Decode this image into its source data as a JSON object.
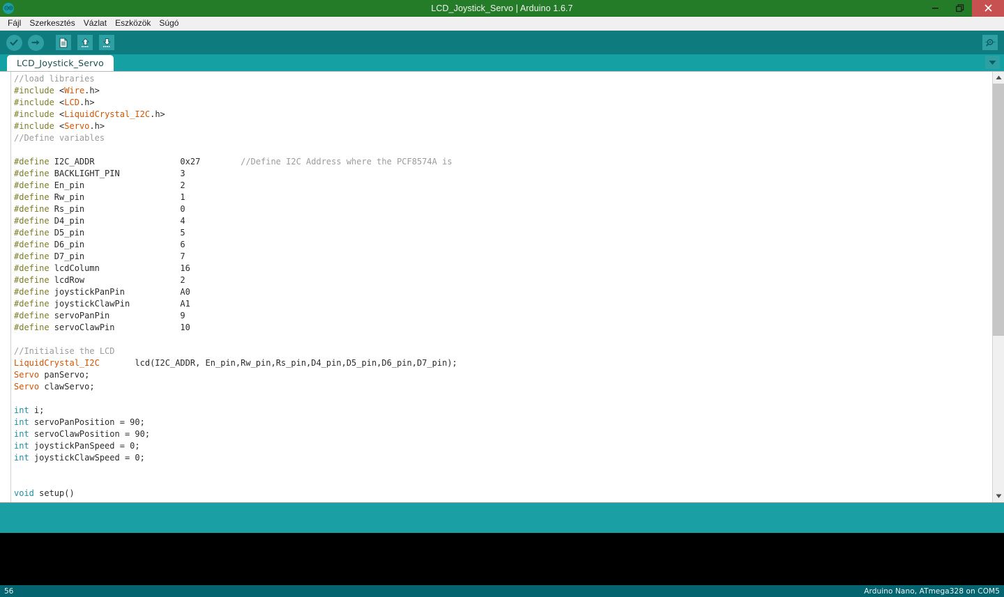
{
  "window": {
    "title": "LCD_Joystick_Servo | Arduino 1.6.7",
    "logo_icon": "arduino-logo-icon",
    "minimize_icon": "minimize-icon",
    "restore_icon": "restore-icon",
    "close_icon": "close-icon",
    "titlebar_color": "#257c28",
    "close_color": "#c75050"
  },
  "menubar": {
    "items": [
      {
        "label": "Fájl",
        "name": "menu-file"
      },
      {
        "label": "Szerkesztés",
        "name": "menu-edit"
      },
      {
        "label": "Vázlat",
        "name": "menu-sketch"
      },
      {
        "label": "Eszközök",
        "name": "menu-tools"
      },
      {
        "label": "Súgó",
        "name": "menu-help"
      }
    ]
  },
  "toolbar": {
    "background": "#0e7b7f",
    "button_bg": "#2ea0a4",
    "buttons": [
      {
        "name": "verify-button",
        "icon": "checkmark-icon",
        "tooltip": "Verify"
      },
      {
        "name": "upload-button",
        "icon": "arrow-right-icon",
        "tooltip": "Upload"
      },
      {
        "name": "new-button",
        "icon": "new-document-icon",
        "tooltip": "New"
      },
      {
        "name": "open-button",
        "icon": "arrow-up-icon",
        "tooltip": "Open"
      },
      {
        "name": "save-button",
        "icon": "arrow-down-icon",
        "tooltip": "Save"
      }
    ],
    "serial_monitor": {
      "name": "serial-monitor-button",
      "icon": "magnifier-icon"
    }
  },
  "tabs": {
    "background": "#15a0a4",
    "active": "LCD_Joystick_Servo",
    "items": [
      {
        "label": "LCD_Joystick_Servo"
      }
    ],
    "menu_icon": "chevron-down-icon"
  },
  "editor": {
    "background": "#ffffff",
    "colors": {
      "comment": "#9b9b9b",
      "preprocessor": "#7d7c28",
      "library": "#d35400",
      "keyword": "#1f8fa3",
      "plain": "#2b2b2b"
    },
    "scrollbar": {
      "up_icon": "chevron-up-icon",
      "down_icon": "chevron-down-icon",
      "thumb_percent": 62
    },
    "lines": [
      [
        {
          "t": "//load libraries",
          "c": "comment"
        }
      ],
      [
        {
          "t": "#include ",
          "c": "pre"
        },
        {
          "t": "<",
          "c": "plain"
        },
        {
          "t": "Wire",
          "c": "lib"
        },
        {
          "t": ".h>",
          "c": "plain"
        }
      ],
      [
        {
          "t": "#include ",
          "c": "pre"
        },
        {
          "t": "<",
          "c": "plain"
        },
        {
          "t": "LCD",
          "c": "lib"
        },
        {
          "t": ".h>",
          "c": "plain"
        }
      ],
      [
        {
          "t": "#include ",
          "c": "pre"
        },
        {
          "t": "<",
          "c": "plain"
        },
        {
          "t": "LiquidCrystal_I2C",
          "c": "lib"
        },
        {
          "t": ".h>",
          "c": "plain"
        }
      ],
      [
        {
          "t": "#include ",
          "c": "pre"
        },
        {
          "t": "<",
          "c": "plain"
        },
        {
          "t": "Servo",
          "c": "lib"
        },
        {
          "t": ".h>",
          "c": "plain"
        }
      ],
      [
        {
          "t": "//Define variables",
          "c": "comment"
        }
      ],
      [
        {
          "t": "",
          "c": "plain"
        }
      ],
      [
        {
          "t": "#define ",
          "c": "pre"
        },
        {
          "t": "I2C_ADDR                 0x27        ",
          "c": "plain"
        },
        {
          "t": "//Define I2C Address where the PCF8574A is",
          "c": "comment"
        }
      ],
      [
        {
          "t": "#define ",
          "c": "pre"
        },
        {
          "t": "BACKLIGHT_PIN            3",
          "c": "plain"
        }
      ],
      [
        {
          "t": "#define ",
          "c": "pre"
        },
        {
          "t": "En_pin                   2",
          "c": "plain"
        }
      ],
      [
        {
          "t": "#define ",
          "c": "pre"
        },
        {
          "t": "Rw_pin                   1",
          "c": "plain"
        }
      ],
      [
        {
          "t": "#define ",
          "c": "pre"
        },
        {
          "t": "Rs_pin                   0",
          "c": "plain"
        }
      ],
      [
        {
          "t": "#define ",
          "c": "pre"
        },
        {
          "t": "D4_pin                   4",
          "c": "plain"
        }
      ],
      [
        {
          "t": "#define ",
          "c": "pre"
        },
        {
          "t": "D5_pin                   5",
          "c": "plain"
        }
      ],
      [
        {
          "t": "#define ",
          "c": "pre"
        },
        {
          "t": "D6_pin                   6",
          "c": "plain"
        }
      ],
      [
        {
          "t": "#define ",
          "c": "pre"
        },
        {
          "t": "D7_pin                   7",
          "c": "plain"
        }
      ],
      [
        {
          "t": "#define ",
          "c": "pre"
        },
        {
          "t": "lcdColumn                16",
          "c": "plain"
        }
      ],
      [
        {
          "t": "#define ",
          "c": "pre"
        },
        {
          "t": "lcdRow                   2",
          "c": "plain"
        }
      ],
      [
        {
          "t": "#define ",
          "c": "pre"
        },
        {
          "t": "joystickPanPin           A0",
          "c": "plain"
        }
      ],
      [
        {
          "t": "#define ",
          "c": "pre"
        },
        {
          "t": "joystickClawPin          A1",
          "c": "plain"
        }
      ],
      [
        {
          "t": "#define ",
          "c": "pre"
        },
        {
          "t": "servoPanPin              9",
          "c": "plain"
        }
      ],
      [
        {
          "t": "#define ",
          "c": "pre"
        },
        {
          "t": "servoClawPin             10",
          "c": "plain"
        }
      ],
      [
        {
          "t": "",
          "c": "plain"
        }
      ],
      [
        {
          "t": "//Initialise the LCD",
          "c": "comment"
        }
      ],
      [
        {
          "t": "LiquidCrystal_I2C",
          "c": "lib"
        },
        {
          "t": "       lcd(I2C_ADDR, En_pin,Rw_pin,Rs_pin,D4_pin,D5_pin,D6_pin,D7_pin);",
          "c": "plain"
        }
      ],
      [
        {
          "t": "Servo",
          "c": "lib"
        },
        {
          "t": " panServo;",
          "c": "plain"
        }
      ],
      [
        {
          "t": "Servo",
          "c": "lib"
        },
        {
          "t": " clawServo;",
          "c": "plain"
        }
      ],
      [
        {
          "t": "",
          "c": "plain"
        }
      ],
      [
        {
          "t": "int",
          "c": "kw"
        },
        {
          "t": " i;",
          "c": "plain"
        }
      ],
      [
        {
          "t": "int",
          "c": "kw"
        },
        {
          "t": " servoPanPosition = 90;",
          "c": "plain"
        }
      ],
      [
        {
          "t": "int",
          "c": "kw"
        },
        {
          "t": " servoClawPosition = 90;",
          "c": "plain"
        }
      ],
      [
        {
          "t": "int",
          "c": "kw"
        },
        {
          "t": " joystickPanSpeed = 0;",
          "c": "plain"
        }
      ],
      [
        {
          "t": "int",
          "c": "kw"
        },
        {
          "t": " joystickClawSpeed = 0;",
          "c": "plain"
        }
      ],
      [
        {
          "t": "",
          "c": "plain"
        }
      ],
      [
        {
          "t": "",
          "c": "plain"
        }
      ],
      [
        {
          "t": "void",
          "c": "kw"
        },
        {
          "t": " setup()",
          "c": "plain"
        }
      ]
    ]
  },
  "message_bar": {
    "text": "",
    "background": "#1a9fa5"
  },
  "console": {
    "text": "",
    "background": "#000000"
  },
  "statusbar": {
    "line_number": "56",
    "board_info": "Arduino Nano, ATmega328 on COM5",
    "background": "#046570"
  }
}
